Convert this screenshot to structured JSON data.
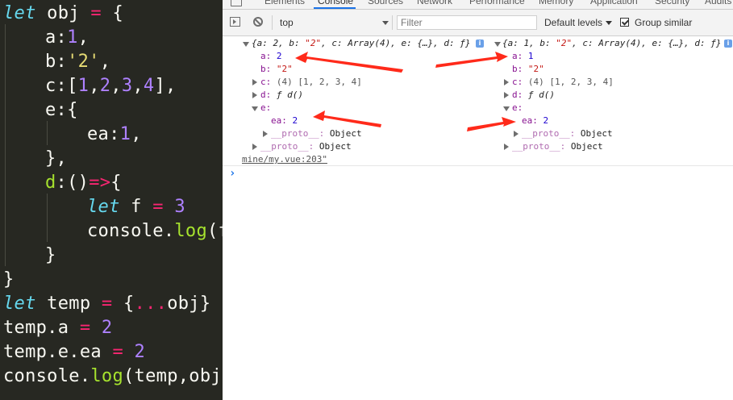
{
  "editor": {
    "lines": [
      {
        "text": "let obj = {"
      },
      {
        "text": "a:1,"
      },
      {
        "text": "b:'2',"
      },
      {
        "text": "c:[1,2,3,4],"
      },
      {
        "text": "e:{"
      },
      {
        "text": "ea:1,"
      },
      {
        "text": "},"
      },
      {
        "text": "d:()=>{"
      },
      {
        "text": "let f = 3"
      },
      {
        "text": "console.log(f"
      },
      {
        "text": "}"
      },
      {
        "text": "}"
      },
      {
        "text": "let temp = {...obj}"
      },
      {
        "text": "temp.a = 2"
      },
      {
        "text": "temp.e.ea = 2"
      },
      {
        "text": "console.log(temp,obj)"
      }
    ]
  },
  "devtools": {
    "tabs": [
      "Elements",
      "Console",
      "Sources",
      "Network",
      "Performance",
      "Memory",
      "Application",
      "Security",
      "Audits"
    ],
    "active_tab": "Console",
    "toolbar": {
      "context": "top",
      "filter_placeholder": "Filter",
      "levels": "Default levels",
      "group_similar_label": "Group similar",
      "group_similar_checked": true
    },
    "console": {
      "temp": {
        "summary_prefix": "{a: 2, b: ",
        "summary_b": "\"2\"",
        "summary_suffix": ", c: Array(4), e: {…}, d: ƒ}",
        "a_key": "a:",
        "a_val": "2",
        "b_key": "b:",
        "b_val": "\"2\"",
        "c_key": "c:",
        "c_val": "(4) [1, 2, 3, 4]",
        "d_key": "d:",
        "d_val": "ƒ d()",
        "e_key": "e:",
        "ea_key": "ea:",
        "ea_val": "2",
        "proto_key": "__proto__:",
        "proto_val": "Object"
      },
      "obj": {
        "summary_prefix": "{a: 1, b: ",
        "summary_b": "\"2\"",
        "summary_suffix": ", c: Array(4), e: {…}, d: ƒ}",
        "a_key": "a:",
        "a_val": "1",
        "b_key": "b:",
        "b_val": "\"2\"",
        "c_key": "c:",
        "c_val": "(4) [1, 2, 3, 4]",
        "d_key": "d:",
        "d_val": "ƒ d()",
        "e_key": "e:",
        "ea_key": "ea:",
        "ea_val": "2",
        "proto_key": "__proto__:",
        "proto_val": "Object"
      },
      "source_link": "mine/my.vue:203\"",
      "prompt_glyph": "›",
      "info_glyph": "i"
    },
    "annotation_color": "#ff2a1a"
  }
}
